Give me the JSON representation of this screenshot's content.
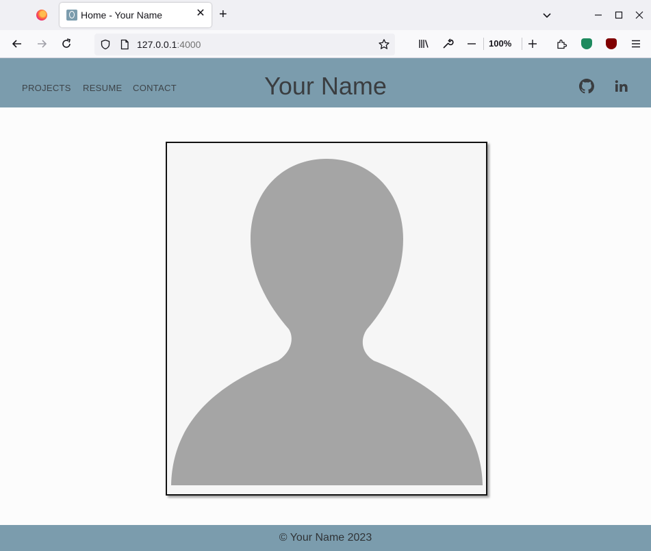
{
  "browser": {
    "tab": {
      "title": "Home - Your Name",
      "close": "✕"
    },
    "new_tab": "+",
    "url": {
      "host": "127.0.0.1",
      "port": ":4000"
    },
    "zoom": "100%",
    "window_controls": {
      "minimize": "—",
      "maximize": "☐",
      "close": "✕"
    },
    "icons": [
      "firefox-logo",
      "back-icon",
      "forward-icon",
      "reload-icon",
      "shield-icon",
      "page-icon",
      "star-icon",
      "library-icon",
      "wrench-icon",
      "zoom-out-icon",
      "zoom-in-icon",
      "extensions-icon",
      "privacy-badger-icon",
      "ublock-icon",
      "menu-icon"
    ]
  },
  "site": {
    "nav": [
      {
        "label": "PROJECTS"
      },
      {
        "label": "RESUME"
      },
      {
        "label": "CONTACT"
      }
    ],
    "title": "Your Name",
    "social": [
      "github-icon",
      "linkedin-icon"
    ],
    "footer": "© Your Name 2023"
  },
  "colors": {
    "header_bg": "#7b9cad",
    "page_bg": "#fcfcfc",
    "silhouette": "#a5a5a5"
  }
}
